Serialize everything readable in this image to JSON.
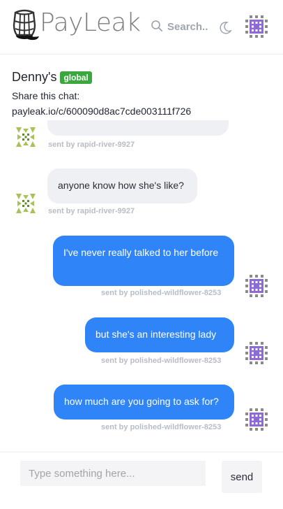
{
  "header": {
    "brand": "PayLeak",
    "search_placeholder": "Search.."
  },
  "chat": {
    "title": "Denny's",
    "scope_badge": "global",
    "share_label": "Share this chat:",
    "share_link": "payleak.io/c/600090d8ac7cde003111f726"
  },
  "messages": [
    {
      "direction": "in",
      "text": "",
      "sender": "sent by rapid-river-9927"
    },
    {
      "direction": "in",
      "text": "anyone know how she's like?",
      "sender": "sent by rapid-river-9927"
    },
    {
      "direction": "out",
      "text": "I've never really talked to her before",
      "sender": "sent by polished-wildflower-8253"
    },
    {
      "direction": "out",
      "text": "but she's an interesting lady",
      "sender": "sent by polished-wildflower-8253"
    },
    {
      "direction": "out",
      "text": "how much are you going to ask for?",
      "sender": "sent by polished-wildflower-8253"
    }
  ],
  "composer": {
    "placeholder": "Type something here...",
    "send_label": "send"
  },
  "colors": {
    "outgoing_bubble": "#2f85f8",
    "incoming_bubble": "#eff0f4",
    "badge_green": "#3aa83f"
  },
  "icons": {
    "logo": "barrel-logo-icon",
    "search": "search-icon",
    "theme": "moon-icon",
    "other_user_avatar": "green-identicon",
    "self_avatar": "purple-identicon"
  }
}
